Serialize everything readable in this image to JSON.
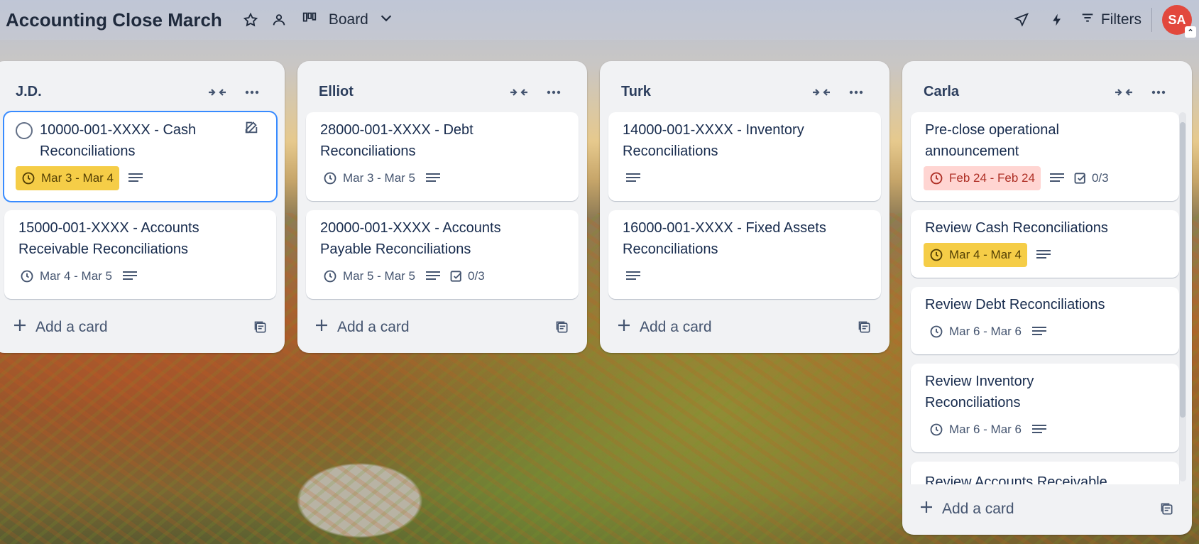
{
  "header": {
    "board_title": "Accounting Close March",
    "view_label": "Board",
    "filters_label": "Filters",
    "avatar_initials": "SA"
  },
  "lists": [
    {
      "name": "J.D.",
      "add_card_label": "Add a card",
      "cards": [
        {
          "title_line1": "10000-001-XXXX - Cash",
          "title_line2": "Reconciliations",
          "dates": "Mar 3 - Mar 4",
          "date_style": "yellow"
        },
        {
          "title_line1": "15000-001-XXXX - Accounts",
          "title_line2": "Receivable Reconciliations",
          "dates": "Mar 4 - Mar 5",
          "date_style": "plain"
        }
      ]
    },
    {
      "name": "Elliot",
      "add_card_label": "Add a card",
      "cards": [
        {
          "title_line1": "28000-001-XXXX - Debt",
          "title_line2": "Reconciliations",
          "dates": "Mar 3 - Mar 5",
          "date_style": "plain"
        },
        {
          "title_line1": "20000-001-XXXX - Accounts",
          "title_line2": "Payable Reconciliations",
          "dates": "Mar 5 - Mar 5",
          "date_style": "plain",
          "checklist": "0/3"
        }
      ]
    },
    {
      "name": "Turk",
      "add_card_label": "Add a card",
      "cards": [
        {
          "title_line1": "14000-001-XXXX - Inventory",
          "title_line2": "Reconciliations"
        },
        {
          "title_line1": "16000-001-XXXX - Fixed Assets",
          "title_line2": "Reconciliations"
        }
      ]
    },
    {
      "name": "Carla",
      "add_card_label": "Add a card",
      "cards": [
        {
          "title_line1": "Pre-close operational",
          "title_line2": "announcement",
          "dates": "Feb 24 - Feb 24",
          "date_style": "red",
          "checklist": "0/3"
        },
        {
          "title_line1": "Review Cash Reconciliations",
          "dates": "Mar 4 - Mar 4",
          "date_style": "yellow"
        },
        {
          "title_line1": "Review Debt Reconciliations",
          "dates": "Mar 6 - Mar 6",
          "date_style": "plain"
        },
        {
          "title_line1": "Review Inventory",
          "title_line2": "Reconciliations",
          "dates": "Mar 6 - Mar 6",
          "date_style": "plain"
        },
        {
          "title_line1": "Review Accounts Receivable"
        }
      ]
    }
  ],
  "colors": {
    "accent_blue": "#388bff",
    "yellow_badge": "#f5cd47",
    "red_badge": "#ffd5d2",
    "avatar": "#e2483d"
  }
}
